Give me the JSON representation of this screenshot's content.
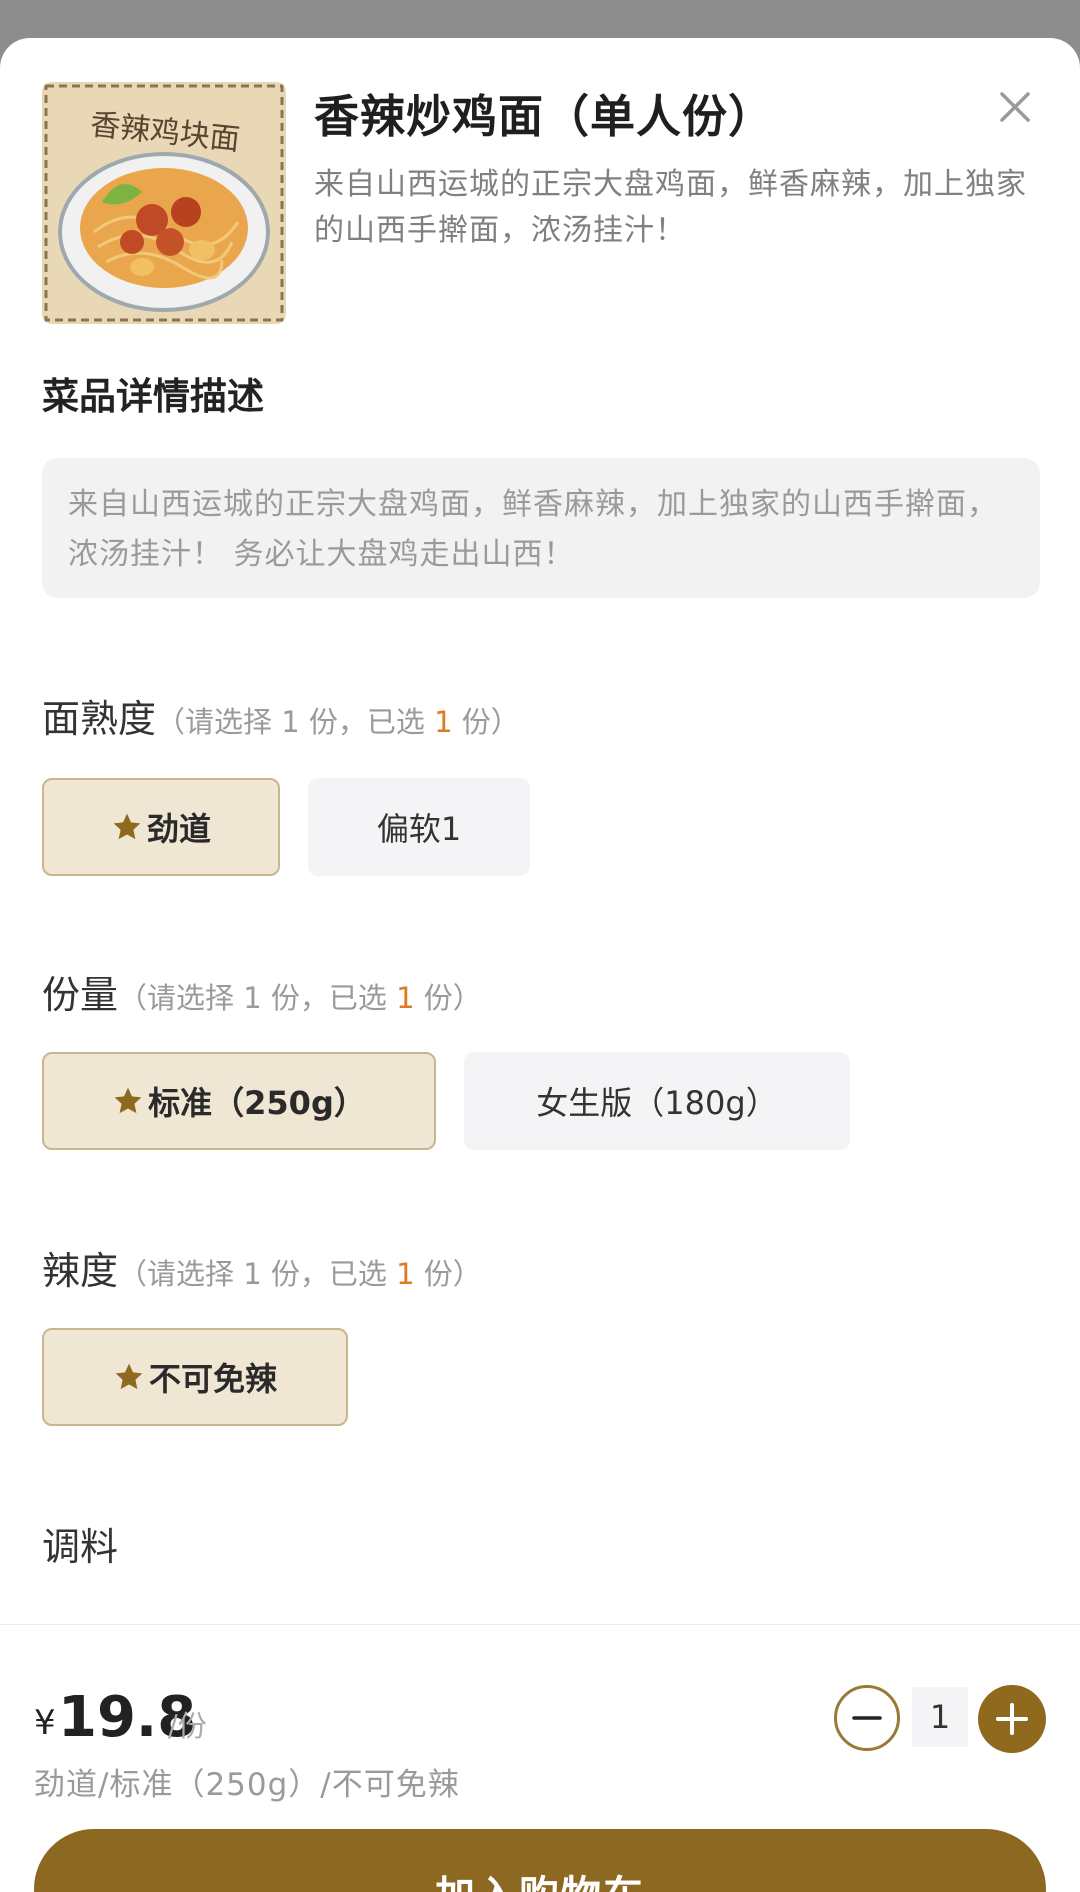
{
  "dish": {
    "image_text": "香辣鸡块面",
    "title": "香辣炒鸡面（单人份）",
    "subtitle": "来自山西运城的正宗大盘鸡面，鲜香麻辣，加上独家的山西手擀面，浓汤挂汁！"
  },
  "detail": {
    "heading": "菜品详情描述",
    "text": "来自山西运城的正宗大盘鸡面，鲜香麻辣，加上独家的山西手擀面，浓汤挂汁！ 务必让大盘鸡走出山西！"
  },
  "groups": {
    "doneness": {
      "name": "面熟度",
      "rule_prefix": "（请选择 1 份，已选 ",
      "selected_count": "1",
      "rule_suffix": " 份）",
      "options": [
        "劲道",
        "偏软1"
      ],
      "selected": "劲道"
    },
    "portion": {
      "name": "份量",
      "rule_prefix": "（请选择 1 份，已选 ",
      "selected_count": "1",
      "rule_suffix": " 份）",
      "options": [
        "标准（250g）",
        "女生版（180g）"
      ],
      "selected": "标准（250g）"
    },
    "spice": {
      "name": "辣度",
      "rule_prefix": "（请选择 1 份，已选 ",
      "selected_count": "1",
      "rule_suffix": " 份）",
      "options": [
        "不可免辣"
      ],
      "selected": "不可免辣"
    },
    "seasoning": {
      "name": "调料"
    }
  },
  "footer": {
    "currency": "¥",
    "price": "19.8",
    "unit": "/份",
    "summary": "劲道/标准（250g）/不可免辣",
    "quantity": "1",
    "add_to_cart": "加入购物车"
  },
  "colors": {
    "accent": "#8c6820",
    "selected_bg": "#efe6d3",
    "highlight": "#e07b23"
  },
  "icons": [
    "close-icon",
    "star-icon",
    "minus-icon",
    "plus-icon"
  ]
}
